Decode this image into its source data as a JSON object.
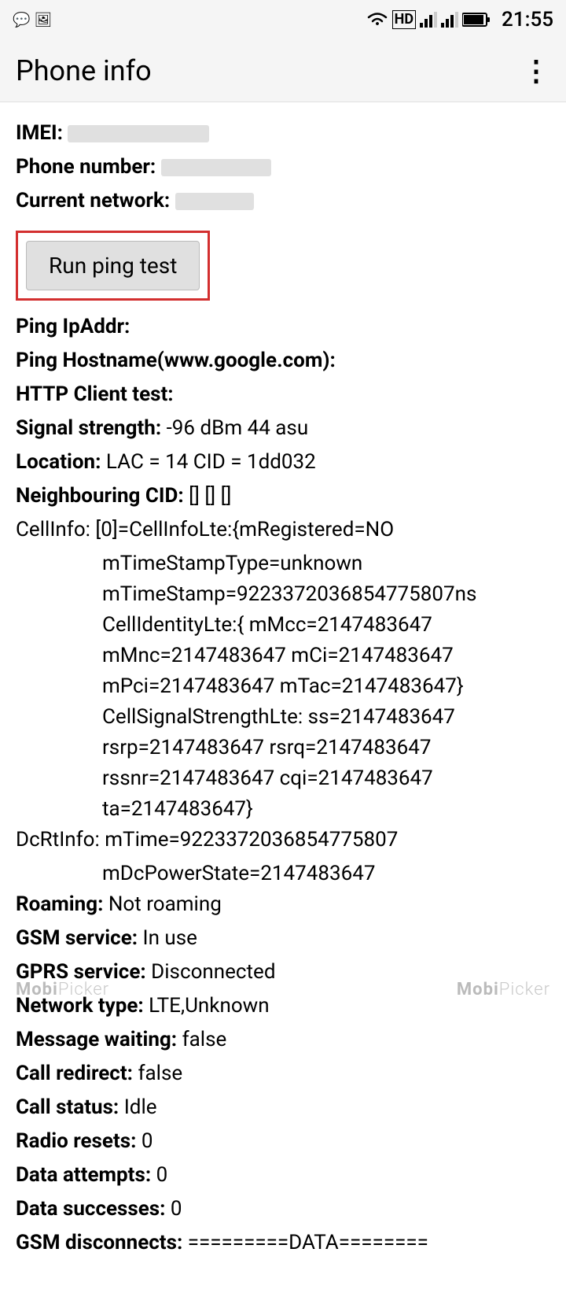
{
  "statusBar": {
    "time": "21:55",
    "icons": [
      "whatsapp",
      "gallery",
      "wifi",
      "hd",
      "signal1",
      "signal2",
      "battery"
    ]
  },
  "appBar": {
    "title": "Phone info",
    "menuIcon": "⋮"
  },
  "info": {
    "imei_label": "IMEI:",
    "imei_value": "",
    "phone_label": "Phone number:",
    "phone_value": "",
    "network_label": "Current network:",
    "network_value": "",
    "ping_button": "Run ping test",
    "pingip_label": "Ping IpAddr:",
    "pingip_value": "",
    "pinghostname_label": "Ping Hostname(www.google.com):",
    "pinghostname_value": "",
    "http_label": "HTTP Client test:",
    "http_value": "",
    "signal_label": "Signal strength:",
    "signal_value": "-96 dBm   44 asu",
    "location_label": "Location:",
    "location_value": "LAC = 14   CID = 1dd032",
    "neighbouring_label": "Neighbouring CID:",
    "neighbouring_value": "[] [] []",
    "cellinfo_label": "CellInfo:",
    "cellinfo_value": "[0]=CellInfoLte:{mRegistered=NO",
    "cellinfo_line2": "mTimeStampType=unknown",
    "cellinfo_line3": "mTimeStamp=922337203685477580​7ns",
    "cellinfo_line4": "CellIdentityLte:{ mMcc=2147483647",
    "cellinfo_line5": "mMnc=2147483647 mCi=2147483647",
    "cellinfo_line6": "mPci=2147483647 mTac=2147483647}",
    "cellinfo_line7": "CellSignalStrengthLte: ss=2147483647",
    "cellinfo_line8": "rsrp=2147483647 rsrq=2147483647",
    "cellinfo_line9": "rssnr=2147483647 cqi=2147483647",
    "cellinfo_line10": "ta=2147483647}",
    "dcrtinfo_label": "DcRtInfo:",
    "dcrtinfo_value": "mTime=9223372036854775807",
    "dcrtinfo_line2": "mDcPowerState=2147483647",
    "roaming_label": "Roaming:",
    "roaming_value": "Not roaming",
    "gsm_label": "GSM service:",
    "gsm_value": "In use",
    "gprs_label": "GPRS service:",
    "gprs_value": "Disconnected",
    "network_type_label": "Network type:",
    "network_type_value": "LTE,Unknown",
    "msg_waiting_label": "Message waiting:",
    "msg_waiting_value": "false",
    "call_redirect_label": "Call redirect:",
    "call_redirect_value": "false",
    "call_status_label": "Call status:",
    "call_status_value": "Idle",
    "radio_resets_label": "Radio resets:",
    "radio_resets_value": "0",
    "data_attempts_label": "Data attempts:",
    "data_attempts_value": "0",
    "data_successes_label": "Data successes:",
    "data_successes_value": "0",
    "gsm_disconnects_label": "GSM disconnects:",
    "gsm_disconnects_value": "=========DATA========"
  },
  "watermark": {
    "left": "Mobi Picker",
    "right": "MobiPicker"
  }
}
